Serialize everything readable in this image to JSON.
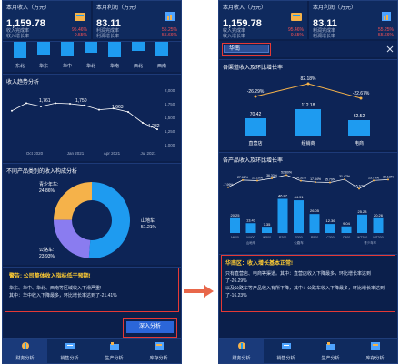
{
  "left": {
    "header": {
      "cards": [
        {
          "title": "本月收入（万元）",
          "value": "1,159.78",
          "row1_label": "收入完成率",
          "row1_value": "95.46%",
          "row2_label": "收入增长率",
          "row2_value": "-9.55%"
        },
        {
          "title": "本月利润（万元）",
          "value": "83.11",
          "row1_label": "利润完成率",
          "row1_value": "55.25%",
          "row2_label": "利润增长率",
          "row2_value": "-55.66%"
        }
      ]
    },
    "region_axis": [
      "东北",
      "华东",
      "华中",
      "华北",
      "华南",
      "西北",
      "西南"
    ],
    "trend": {
      "title": "收入趋势分析",
      "y_ticks": [
        "2,000",
        "1,750",
        "1,500",
        "1,250",
        "1,000"
      ],
      "x_ticks": [
        "Oct 2020",
        "Jan 2021",
        "Apr 2021",
        "Jul 2021"
      ],
      "labels": [
        "1,761",
        "1,750",
        "1,663",
        "1,282"
      ]
    },
    "chart_data": {
      "type": "line",
      "title": "收入趋势分析",
      "xlabel": "",
      "ylabel": "",
      "ylim": [
        1000,
        2000
      ],
      "x_ticks": [
        "Oct 2020",
        "Jan 2021",
        "Apr 2021",
        "Jul 2021"
      ],
      "series": [
        {
          "name": "",
          "values": [
            1620,
            1761,
            1700,
            1760,
            1750,
            1720,
            1640,
            1663,
            1600,
            1400,
            1282
          ]
        }
      ],
      "annotations": [
        "1,761",
        "1,750",
        "1,663",
        "1,282"
      ]
    },
    "donut": {
      "title": "不同产品类别的收入构成分析",
      "labels": [
        {
          "name": "青少年车:",
          "pct": "24.86%"
        },
        {
          "name": "公路车:",
          "pct": "23.93%"
        },
        {
          "name": "山地车:",
          "pct": "51.21%"
        }
      ],
      "values": [
        51.21,
        23.93,
        24.86
      ],
      "colors": [
        "#1e9bf0",
        "#8a7cf0",
        "#f5b24a"
      ]
    },
    "warning": {
      "title": "警告: 公司整体收入指标低于预期!",
      "line1": "华东、华中、华北、西南等区域收入下滑严重!",
      "line2": "其中：华中收入下降最多，环比增长率达到了-21.41%"
    },
    "button": "深入分析",
    "nav": [
      "财务分析",
      "销售分析",
      "生产分析",
      "库存分析"
    ]
  },
  "right": {
    "header": {
      "cards": [
        {
          "title": "本月收入（万元）",
          "value": "1,159.78",
          "row1_label": "收入完成率",
          "row1_value": "95.46%",
          "row2_label": "收入增长率",
          "row2_value": "-9.55%"
        },
        {
          "title": "本月利润（万元）",
          "value": "83.11",
          "row1_label": "利润完成率",
          "row1_value": "55.25%",
          "row2_label": "利润增长率",
          "row2_value": "-55.66%"
        }
      ]
    },
    "region_select": "华南",
    "channel_chart": {
      "title": "各渠道收入及环比增长率",
      "line_labels": [
        "-26.29%",
        "82.18%",
        "-22.67%"
      ],
      "bar_labels": [
        "70.42",
        "112.18",
        "62.52"
      ],
      "categories": [
        "直营店",
        "经销商",
        "电商"
      ]
    },
    "product_chart": {
      "title": "各产品收入及环比增长率",
      "line_labels": [
        "-7.99%",
        "27.68%",
        "25.10%",
        "36.33%",
        "52.80%",
        "24.32%",
        "17.84%",
        "15.79%",
        "31.47%",
        "-15.10%",
        "25.79%",
        "30.13%"
      ],
      "bar_labels": [
        "20.25",
        "13.43",
        "7.35",
        "46.87",
        "44.91",
        "26.05",
        "12.36",
        "9.04",
        "25.28",
        "20.26"
      ],
      "categories": [
        "M600",
        "W400",
        "W500",
        "R200",
        "R300",
        "R500",
        "C300",
        "C400",
        "WT200",
        "WT300"
      ],
      "group_labels": [
        "山地车",
        "公路车",
        "青少年车"
      ]
    },
    "info": {
      "title": "华南区：收入增长基本正常!",
      "line1": "只有直营店、电商等渠道。其中：直营店收入下降最多，环比增长率达到了-26.29%",
      "line2": "以及公路车等产品收入有所下降，其中：公路车收入下降最多，环比增长率达到了-16.23%"
    },
    "nav": [
      "财务分析",
      "销售分析",
      "生产分析",
      "库存分析"
    ]
  }
}
